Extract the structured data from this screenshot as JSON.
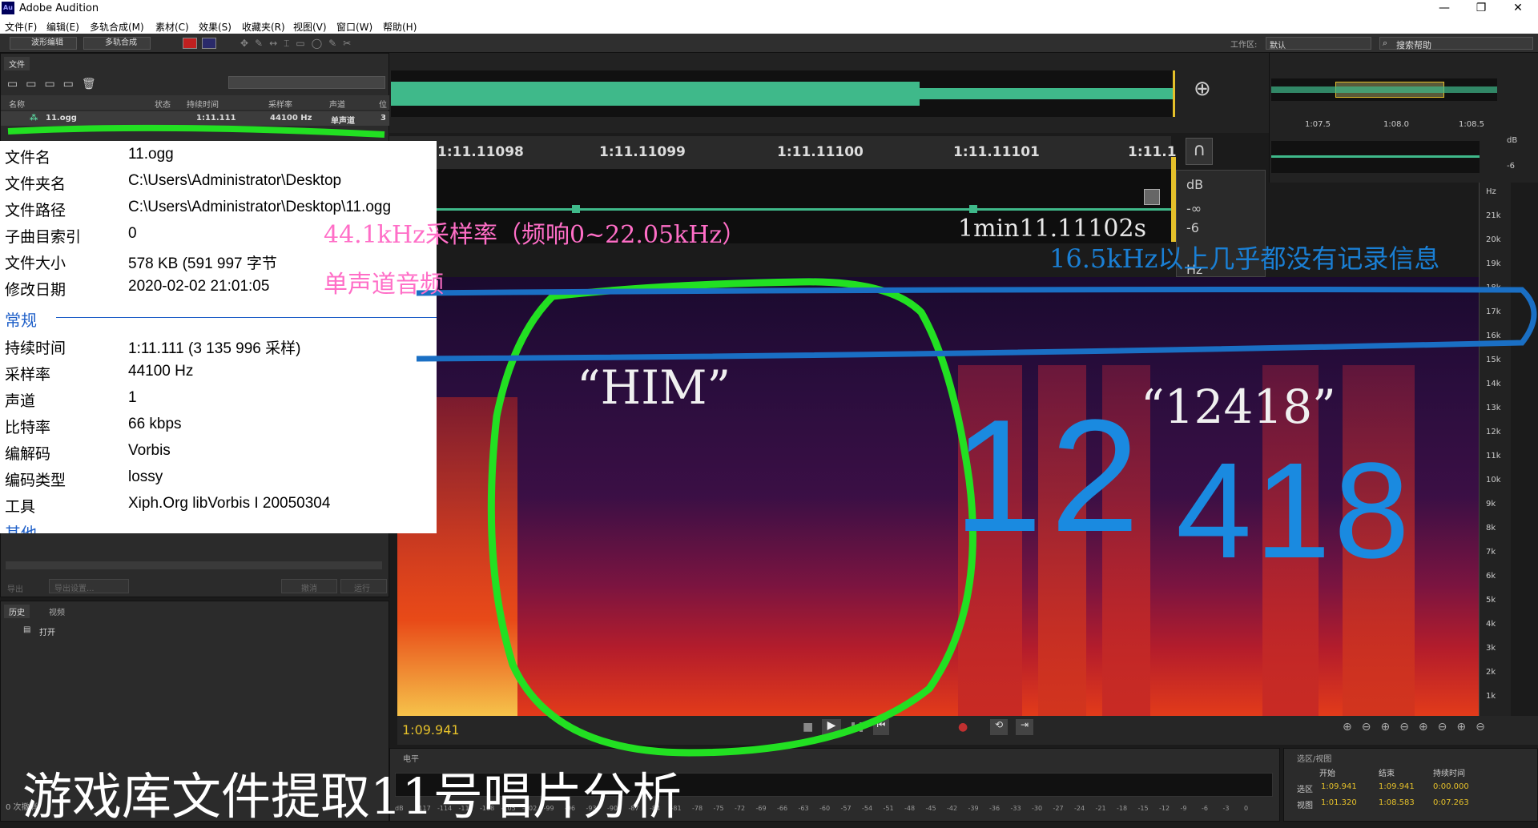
{
  "app": {
    "title": "Adobe Audition",
    "logo_text": "Au",
    "min_label": "—",
    "max_label": "❐",
    "close_label": "✕"
  },
  "menu": [
    "文件(F)",
    "编辑(E)",
    "多轨合成(M)",
    "素材(C)",
    "效果(S)",
    "收藏夹(R)",
    "视图(V)",
    "窗口(W)",
    "帮助(H)"
  ],
  "toolbar": {
    "waveform_edit": "波形编辑",
    "multitrack": "多轨合成",
    "workspace_label": "工作区:",
    "workspace_value": "默认",
    "search_placeholder": "搜索帮助"
  },
  "files_panel": {
    "tab": "文件",
    "columns": [
      "名称",
      "状态",
      "持续时间",
      "采样率",
      "声道",
      "位"
    ],
    "row": {
      "name": "11.ogg",
      "duration": "1:11.111",
      "rate": "44100 Hz",
      "channels": "单声道",
      "bits": "3"
    },
    "export_btn": "导出",
    "export_settings": "导出设置...",
    "cancel_btn": "撤消",
    "run_btn": "运行"
  },
  "history_panel": {
    "tab1": "历史",
    "tab2": "视频",
    "item": "打开",
    "status": "0 次撤消"
  },
  "file_info": {
    "rows": [
      {
        "k": "文件名",
        "v": "11.ogg"
      },
      {
        "k": "文件夹名",
        "v": "C:\\Users\\Administrator\\Desktop"
      },
      {
        "k": "文件路径",
        "v": "C:\\Users\\Administrator\\Desktop\\11.ogg"
      },
      {
        "k": "子曲目索引",
        "v": "0"
      },
      {
        "k": "文件大小",
        "v": "578 KB (591 997 字节"
      },
      {
        "k": "修改日期",
        "v": "2020-02-02 21:01:05"
      }
    ],
    "section_general": "常规",
    "general_rows": [
      {
        "k": "持续时间",
        "v": "1:11.111 (3 135 996 采样)"
      },
      {
        "k": "采样率",
        "v": "44100 Hz"
      },
      {
        "k": "声道",
        "v": "1"
      },
      {
        "k": "比特率",
        "v": "66 kbps"
      },
      {
        "k": "编解码",
        "v": "Vorbis"
      },
      {
        "k": "编码类型",
        "v": "lossy"
      },
      {
        "k": "工具",
        "v": "Xiph.Org libVorbis I 20050304"
      }
    ],
    "section_other": "其他"
  },
  "editor": {
    "ruler_ticks": [
      "1:11.11098",
      "1:11.11099",
      "1:11.11100",
      "1:11.11101",
      "1:11.1"
    ],
    "db_labels": [
      "dB",
      "-∞",
      "-6"
    ],
    "hz_label": "Hz",
    "current_time": "1:09.941",
    "freq_labels": [
      "Hz",
      "21k",
      "20k",
      "19k",
      "18k",
      "17k",
      "16k",
      "15k",
      "14k",
      "13k",
      "12k",
      "11k",
      "10k",
      "9k",
      "8k",
      "7k",
      "6k",
      "5k",
      "4k",
      "3k",
      "2k",
      "1k"
    ]
  },
  "right_panel": {
    "ruler": [
      "1:07.5",
      "1:08.0",
      "1:08.5"
    ],
    "db": [
      "dB",
      "-6"
    ]
  },
  "levels": {
    "tab": "电平",
    "ticks": [
      "dB",
      "-117",
      "-114",
      "-111",
      "-108",
      "-105",
      "-102",
      "-99",
      "-96",
      "-93",
      "-90",
      "-87",
      "-84",
      "-81",
      "-78",
      "-75",
      "-72",
      "-69",
      "-66",
      "-63",
      "-60",
      "-57",
      "-54",
      "-51",
      "-48",
      "-45",
      "-42",
      "-39",
      "-36",
      "-33",
      "-30",
      "-27",
      "-24",
      "-21",
      "-18",
      "-15",
      "-12",
      "-9",
      "-6",
      "-3",
      "0"
    ]
  },
  "selection_panel": {
    "tab": "选区/视图",
    "headers": [
      "开始",
      "结束",
      "持续时间"
    ],
    "sel_label": "选区",
    "sel": [
      "1:09.941",
      "1:09.941",
      "0:00.000"
    ],
    "view_label": "视图",
    "view": [
      "1:01.320",
      "1:08.583",
      "0:07.263"
    ]
  },
  "annotations": {
    "sample_rate": "44.1kHz采样率（频响0~22.05kHz）",
    "mono": "单声道音频",
    "time": "1min11.11102s",
    "freq_note": "16.5kHz以上几乎都没有记录信息",
    "him": "“HIM”",
    "num_quote": "“12418”",
    "big_12": "12",
    "big_418": "418",
    "caption": "游戏库文件提取11号唱片分析"
  },
  "colors": {
    "accent_green": "#5cd6a0",
    "highlight_green": "#22e022",
    "annot_blue": "#1a7fd4",
    "annot_pink": "#ff6ec7",
    "time_yellow": "#e5c02a"
  }
}
